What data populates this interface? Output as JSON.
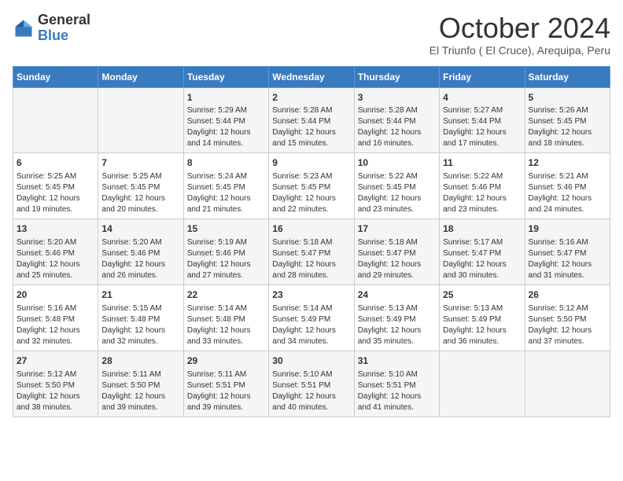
{
  "header": {
    "logo": {
      "general": "General",
      "blue": "Blue"
    },
    "title": "October 2024",
    "location": "El Triunfo ( El Cruce), Arequipa, Peru"
  },
  "weekdays": [
    "Sunday",
    "Monday",
    "Tuesday",
    "Wednesday",
    "Thursday",
    "Friday",
    "Saturday"
  ],
  "weeks": [
    [
      {
        "day": "",
        "sunrise": "",
        "sunset": "",
        "daylight": ""
      },
      {
        "day": "",
        "sunrise": "",
        "sunset": "",
        "daylight": ""
      },
      {
        "day": "1",
        "sunrise": "Sunrise: 5:29 AM",
        "sunset": "Sunset: 5:44 PM",
        "daylight": "Daylight: 12 hours and 14 minutes."
      },
      {
        "day": "2",
        "sunrise": "Sunrise: 5:28 AM",
        "sunset": "Sunset: 5:44 PM",
        "daylight": "Daylight: 12 hours and 15 minutes."
      },
      {
        "day": "3",
        "sunrise": "Sunrise: 5:28 AM",
        "sunset": "Sunset: 5:44 PM",
        "daylight": "Daylight: 12 hours and 16 minutes."
      },
      {
        "day": "4",
        "sunrise": "Sunrise: 5:27 AM",
        "sunset": "Sunset: 5:44 PM",
        "daylight": "Daylight: 12 hours and 17 minutes."
      },
      {
        "day": "5",
        "sunrise": "Sunrise: 5:26 AM",
        "sunset": "Sunset: 5:45 PM",
        "daylight": "Daylight: 12 hours and 18 minutes."
      }
    ],
    [
      {
        "day": "6",
        "sunrise": "Sunrise: 5:25 AM",
        "sunset": "Sunset: 5:45 PM",
        "daylight": "Daylight: 12 hours and 19 minutes."
      },
      {
        "day": "7",
        "sunrise": "Sunrise: 5:25 AM",
        "sunset": "Sunset: 5:45 PM",
        "daylight": "Daylight: 12 hours and 20 minutes."
      },
      {
        "day": "8",
        "sunrise": "Sunrise: 5:24 AM",
        "sunset": "Sunset: 5:45 PM",
        "daylight": "Daylight: 12 hours and 21 minutes."
      },
      {
        "day": "9",
        "sunrise": "Sunrise: 5:23 AM",
        "sunset": "Sunset: 5:45 PM",
        "daylight": "Daylight: 12 hours and 22 minutes."
      },
      {
        "day": "10",
        "sunrise": "Sunrise: 5:22 AM",
        "sunset": "Sunset: 5:45 PM",
        "daylight": "Daylight: 12 hours and 23 minutes."
      },
      {
        "day": "11",
        "sunrise": "Sunrise: 5:22 AM",
        "sunset": "Sunset: 5:46 PM",
        "daylight": "Daylight: 12 hours and 23 minutes."
      },
      {
        "day": "12",
        "sunrise": "Sunrise: 5:21 AM",
        "sunset": "Sunset: 5:46 PM",
        "daylight": "Daylight: 12 hours and 24 minutes."
      }
    ],
    [
      {
        "day": "13",
        "sunrise": "Sunrise: 5:20 AM",
        "sunset": "Sunset: 5:46 PM",
        "daylight": "Daylight: 12 hours and 25 minutes."
      },
      {
        "day": "14",
        "sunrise": "Sunrise: 5:20 AM",
        "sunset": "Sunset: 5:46 PM",
        "daylight": "Daylight: 12 hours and 26 minutes."
      },
      {
        "day": "15",
        "sunrise": "Sunrise: 5:19 AM",
        "sunset": "Sunset: 5:46 PM",
        "daylight": "Daylight: 12 hours and 27 minutes."
      },
      {
        "day": "16",
        "sunrise": "Sunrise: 5:18 AM",
        "sunset": "Sunset: 5:47 PM",
        "daylight": "Daylight: 12 hours and 28 minutes."
      },
      {
        "day": "17",
        "sunrise": "Sunrise: 5:18 AM",
        "sunset": "Sunset: 5:47 PM",
        "daylight": "Daylight: 12 hours and 29 minutes."
      },
      {
        "day": "18",
        "sunrise": "Sunrise: 5:17 AM",
        "sunset": "Sunset: 5:47 PM",
        "daylight": "Daylight: 12 hours and 30 minutes."
      },
      {
        "day": "19",
        "sunrise": "Sunrise: 5:16 AM",
        "sunset": "Sunset: 5:47 PM",
        "daylight": "Daylight: 12 hours and 31 minutes."
      }
    ],
    [
      {
        "day": "20",
        "sunrise": "Sunrise: 5:16 AM",
        "sunset": "Sunset: 5:48 PM",
        "daylight": "Daylight: 12 hours and 32 minutes."
      },
      {
        "day": "21",
        "sunrise": "Sunrise: 5:15 AM",
        "sunset": "Sunset: 5:48 PM",
        "daylight": "Daylight: 12 hours and 32 minutes."
      },
      {
        "day": "22",
        "sunrise": "Sunrise: 5:14 AM",
        "sunset": "Sunset: 5:48 PM",
        "daylight": "Daylight: 12 hours and 33 minutes."
      },
      {
        "day": "23",
        "sunrise": "Sunrise: 5:14 AM",
        "sunset": "Sunset: 5:49 PM",
        "daylight": "Daylight: 12 hours and 34 minutes."
      },
      {
        "day": "24",
        "sunrise": "Sunrise: 5:13 AM",
        "sunset": "Sunset: 5:49 PM",
        "daylight": "Daylight: 12 hours and 35 minutes."
      },
      {
        "day": "25",
        "sunrise": "Sunrise: 5:13 AM",
        "sunset": "Sunset: 5:49 PM",
        "daylight": "Daylight: 12 hours and 36 minutes."
      },
      {
        "day": "26",
        "sunrise": "Sunrise: 5:12 AM",
        "sunset": "Sunset: 5:50 PM",
        "daylight": "Daylight: 12 hours and 37 minutes."
      }
    ],
    [
      {
        "day": "27",
        "sunrise": "Sunrise: 5:12 AM",
        "sunset": "Sunset: 5:50 PM",
        "daylight": "Daylight: 12 hours and 38 minutes."
      },
      {
        "day": "28",
        "sunrise": "Sunrise: 5:11 AM",
        "sunset": "Sunset: 5:50 PM",
        "daylight": "Daylight: 12 hours and 39 minutes."
      },
      {
        "day": "29",
        "sunrise": "Sunrise: 5:11 AM",
        "sunset": "Sunset: 5:51 PM",
        "daylight": "Daylight: 12 hours and 39 minutes."
      },
      {
        "day": "30",
        "sunrise": "Sunrise: 5:10 AM",
        "sunset": "Sunset: 5:51 PM",
        "daylight": "Daylight: 12 hours and 40 minutes."
      },
      {
        "day": "31",
        "sunrise": "Sunrise: 5:10 AM",
        "sunset": "Sunset: 5:51 PM",
        "daylight": "Daylight: 12 hours and 41 minutes."
      },
      {
        "day": "",
        "sunrise": "",
        "sunset": "",
        "daylight": ""
      },
      {
        "day": "",
        "sunrise": "",
        "sunset": "",
        "daylight": ""
      }
    ]
  ]
}
